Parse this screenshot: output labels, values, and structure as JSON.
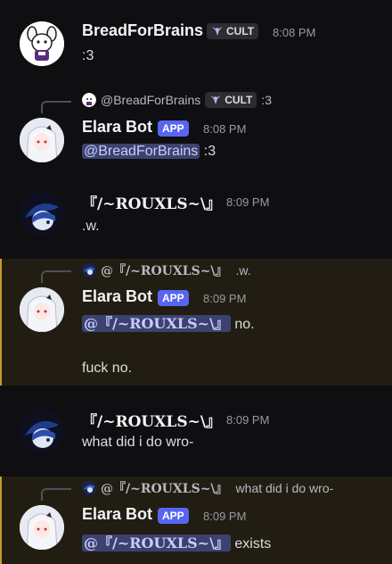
{
  "messages": [
    {
      "author": "BreadForBrains",
      "tag": "CULT",
      "time": "8:08 PM",
      "text": ":3"
    },
    {
      "reply": {
        "author": "@BreadForBrains",
        "tag": "CULT",
        "text": ":3"
      },
      "author": "Elara Bot",
      "tag": "APP",
      "time": "8:08 PM",
      "mention": "@BreadForBrains",
      "text": ":3"
    },
    {
      "author": "『/~ROUXLS~\\』",
      "time": "8:09 PM",
      "text": ".w."
    },
    {
      "reply": {
        "author": "@『/~ROUXLS~\\』",
        "text": ".w."
      },
      "author": "Elara Bot",
      "tag": "APP",
      "time": "8:09 PM",
      "mention": "@『/~ROUXLS~\\』",
      "text": "no.",
      "text2": "fuck no."
    },
    {
      "author": "『/~ROUXLS~\\』",
      "time": "8:09 PM",
      "text": "what did i do wro-"
    },
    {
      "reply": {
        "author": "@『/~ROUXLS~\\』",
        "text": "what did i do wro-"
      },
      "author": "Elara Bot",
      "tag": "APP",
      "time": "8:09 PM",
      "mention": "@『/~ROUXLS~\\』",
      "text": "exists"
    }
  ],
  "colors": {
    "background": "#0f0f12",
    "highlight": "#221d12",
    "highlight_border": "#c79a2b",
    "app_badge": "#5865f2",
    "mention_bg": "#3c4270"
  },
  "icons": {
    "cult_tag": "goat-head-icon",
    "avatar_bread": "white-goat-avatar",
    "avatar_elara": "white-hair-anime-avatar",
    "avatar_rouxls": "blue-hat-avatar"
  }
}
